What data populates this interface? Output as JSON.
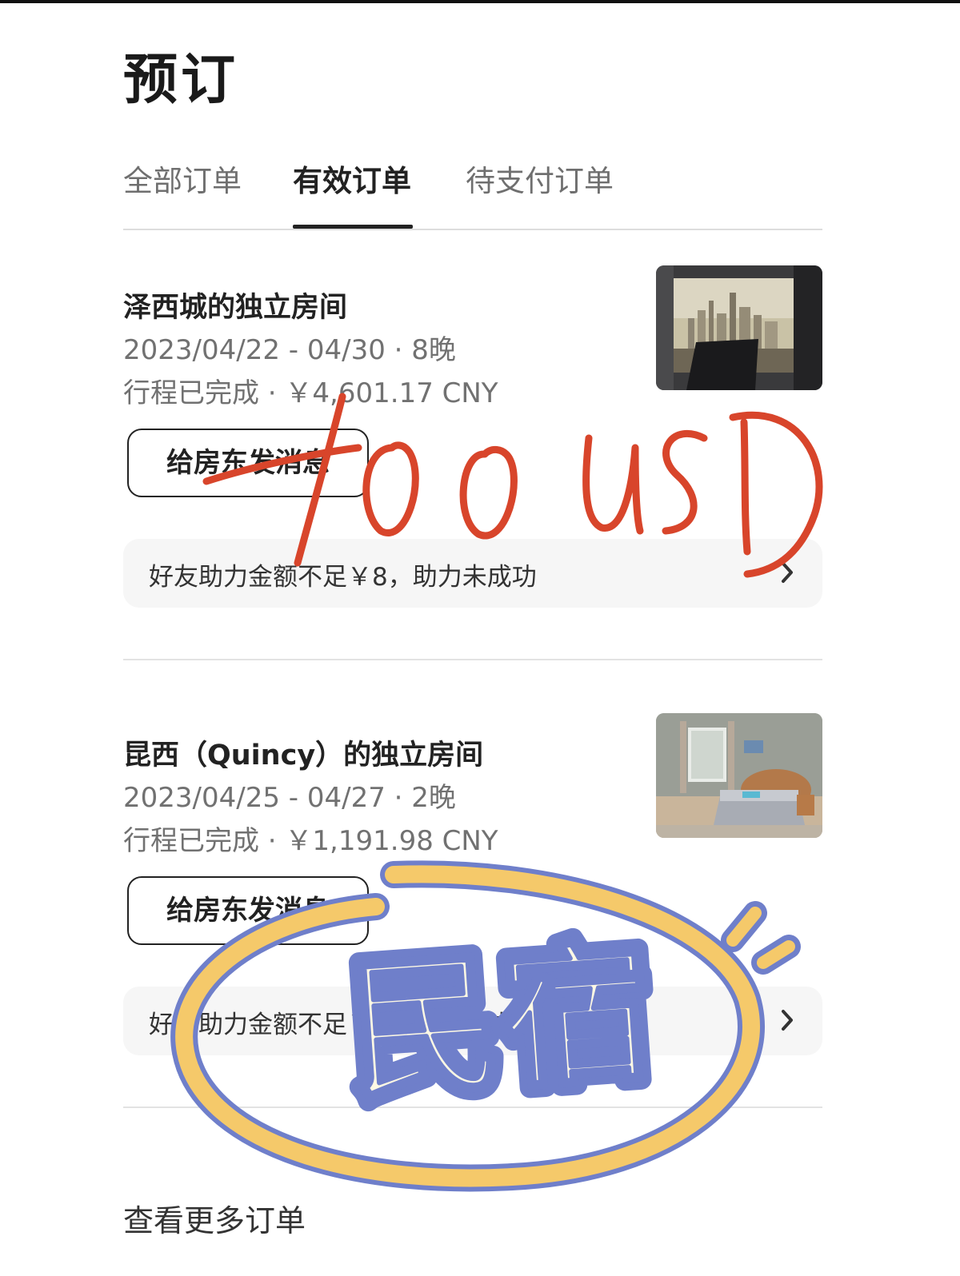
{
  "header": {
    "title": "预订"
  },
  "tabs": [
    {
      "label": "全部订单",
      "active": false
    },
    {
      "label": "有效订单",
      "active": true
    },
    {
      "label": "待支付订单",
      "active": false
    }
  ],
  "orders": [
    {
      "title": "泽西城的独立房间",
      "dates": "2023/04/22 - 04/30 · 8晚",
      "status_price": "行程已完成 · ￥4,601.17 CNY",
      "message_button": "给房东发消息",
      "notice": "好友助力金额不足￥8，助力未成功",
      "thumbnail": "city-skyline-window-photo"
    },
    {
      "title": "昆西（Quincy）的独立房间",
      "dates": "2023/04/25 - 04/27 · 2晚",
      "status_price": "行程已完成 · ￥1,191.98 CNY",
      "message_button": "给房东发消息",
      "notice": "好友助力金额不足￥8，助力未成功",
      "thumbnail": "bedroom-photo"
    }
  ],
  "footer": {
    "more_orders": "查看更多订单"
  },
  "annotations": {
    "handwriting": "100 USD",
    "sticker": "民宿"
  },
  "colors": {
    "ink": "#d8452b",
    "sticker_fill": "#fdf8e4",
    "sticker_outline": "#6f7fca",
    "ring_yellow": "#f5c96a"
  }
}
